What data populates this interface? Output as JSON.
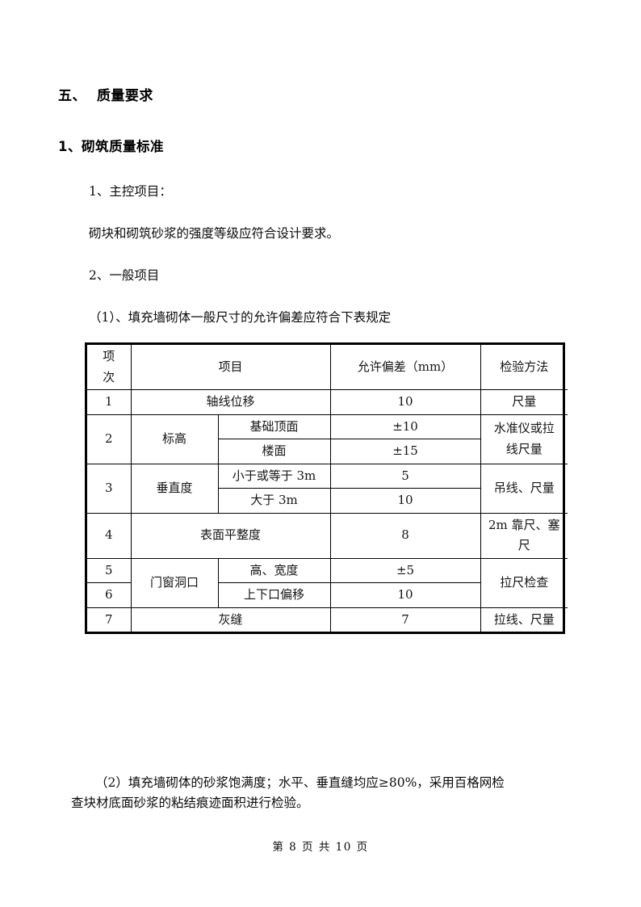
{
  "document": {
    "section_heading": "五、  质量要求",
    "sub_heading": "1、砌筑质量标准",
    "paragraphs": {
      "p1": "1、主控项目：",
      "p2": "砌块和砌筑砂浆的强度等级应符合设计要求。",
      "p3": "2、一般项目",
      "p4": "（1）、填充墙砌体一般尺寸的允许偏差应符合下表规定"
    },
    "closing": {
      "line1": "（2）填充墙砌体的砂浆饱满度；水平、垂直缝均应≥80%，采用百格网检",
      "line2": "查块材底面砂浆的粘结痕迹面积进行检验。"
    },
    "footer": "第 8 页 共 10 页"
  },
  "table": {
    "headers": {
      "index": "项次",
      "index_line1": "项",
      "index_line2": "次",
      "item": "项目",
      "deviation": "允许偏差（mm）",
      "method": "检验方法"
    },
    "rows": [
      {
        "index": "1",
        "item": "轴线位移",
        "deviation": "10",
        "method": "尺量"
      },
      {
        "index": "2",
        "item": "标高",
        "method_line1": "水准仪或拉",
        "method_line2": "线尺量",
        "subrows": [
          {
            "sub_item": "基础顶面",
            "deviation": "±10"
          },
          {
            "sub_item": "楼面",
            "deviation": "±15"
          }
        ]
      },
      {
        "index": "3",
        "item": "垂直度",
        "method": "吊线、尺量",
        "subrows": [
          {
            "sub_item": "小于或等于 3m",
            "deviation": "5"
          },
          {
            "sub_item": "大于 3m",
            "deviation": "10"
          }
        ]
      },
      {
        "index": "4",
        "item": "表面平整度",
        "deviation": "8",
        "method_line1": "2m 靠尺、塞",
        "method_line2": "尺"
      },
      {
        "index": "5",
        "item": "门窗洞口",
        "sub_item": "高、宽度",
        "deviation": "±5",
        "method": "拉尺检查"
      },
      {
        "index": "6",
        "sub_item": "上下口偏移",
        "deviation": "10"
      },
      {
        "index": "7",
        "item": "灰缝",
        "deviation": "7",
        "method": "拉线、尺量"
      }
    ]
  }
}
